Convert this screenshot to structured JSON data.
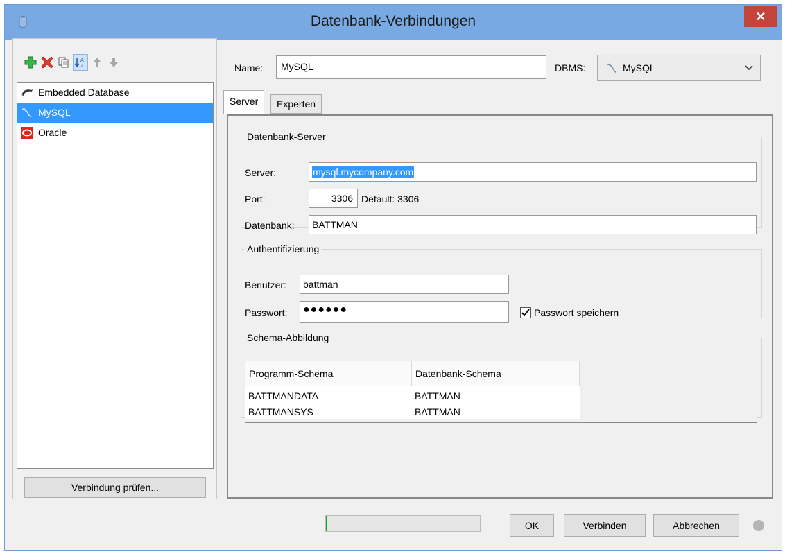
{
  "window": {
    "title": "Datenbank-Verbindungen",
    "close_glyph": "✕"
  },
  "toolbar": {
    "icons": [
      "add-icon",
      "delete-icon",
      "copy-icon",
      "sort-az-icon",
      "move-up-icon",
      "move-down-icon"
    ]
  },
  "connections": [
    {
      "label": "Embedded Database",
      "icon": "embedded-db-icon"
    },
    {
      "label": "MySQL",
      "icon": "mysql-icon",
      "selected": true
    },
    {
      "label": "Oracle",
      "icon": "oracle-icon"
    }
  ],
  "test_button": "Verbindung prüfen...",
  "header": {
    "name_label": "Name:",
    "name_value": "MySQL",
    "dbms_label": "DBMS:",
    "dbms_value": "MySQL"
  },
  "tabs": [
    {
      "label": "Server",
      "active": true
    },
    {
      "label": "Experten",
      "active": false
    }
  ],
  "server_group": {
    "legend": "Datenbank-Server",
    "server_label": "Server:",
    "server_value": "mysql.mycompany.com",
    "port_label": "Port:",
    "port_value": "3306",
    "port_default": "Default: 3306",
    "database_label": "Datenbank:",
    "database_value": "BATTMAN"
  },
  "auth_group": {
    "legend": "Authentifizierung",
    "user_label": "Benutzer:",
    "user_value": "battman",
    "password_label": "Passwort:",
    "password_masked": "●●●●●●",
    "save_password_label": "Passwort speichern",
    "save_password_checked": true
  },
  "schema_group": {
    "legend": "Schema-Abbildung",
    "columns": [
      "Programm-Schema",
      "Datenbank-Schema"
    ],
    "rows": [
      [
        "BATTMANDATA",
        "BATTMAN"
      ],
      [
        "BATTMANSYS",
        "BATTMAN"
      ]
    ]
  },
  "footer": {
    "progress": 0.0,
    "ok_label": "OK",
    "connect_label": "Verbinden",
    "cancel_label": "Abbrechen"
  },
  "colors": {
    "titlebar": "#78a9e3",
    "close": "#c4433a",
    "selection": "#3399ff",
    "add_green": "#3bb54a",
    "delete_red": "#e03c31",
    "oracle_red": "#e2231a"
  }
}
